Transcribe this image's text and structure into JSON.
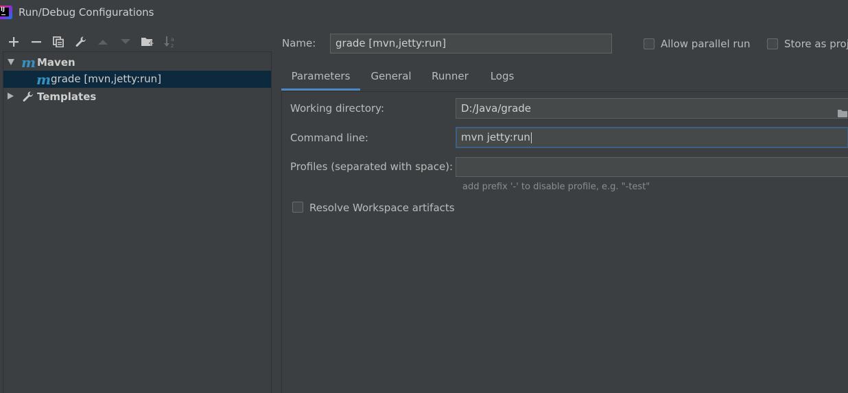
{
  "window": {
    "title": "Run/Debug Configurations"
  },
  "toolbar": {
    "icons": [
      "plus-icon",
      "minus-icon",
      "copy-icon",
      "wrench-icon",
      "arrow-up-icon",
      "arrow-down-icon",
      "folder-add-icon",
      "sort-alpha-icon"
    ]
  },
  "tree": {
    "maven": {
      "label": "Maven"
    },
    "config": {
      "label": "grade [mvn,jetty:run]"
    },
    "templates": {
      "label": "Templates"
    }
  },
  "header": {
    "name_label": "Name:",
    "name_value": "grade [mvn,jetty:run]",
    "allow_parallel_label": "Allow parallel run",
    "store_label": "Store as proj"
  },
  "tabs": [
    {
      "label": "Parameters",
      "active": true
    },
    {
      "label": "General"
    },
    {
      "label": "Runner"
    },
    {
      "label": "Logs"
    }
  ],
  "params": {
    "working_dir_label": "Working directory:",
    "working_dir_value": "D:/Java/grade",
    "command_line_label": "Command line:",
    "command_line_value": "mvn jetty:run",
    "profiles_label": "Profiles (separated with space):",
    "profiles_value": "",
    "profiles_hint": "add prefix '-' to disable profile, e.g. \"-test\"",
    "resolve_label": "Resolve Workspace artifacts"
  },
  "colors": {
    "background": "#3c3f41",
    "selection": "#0d293e",
    "tab_underline": "#4a88c7",
    "maven_icon": "#3592c4"
  }
}
